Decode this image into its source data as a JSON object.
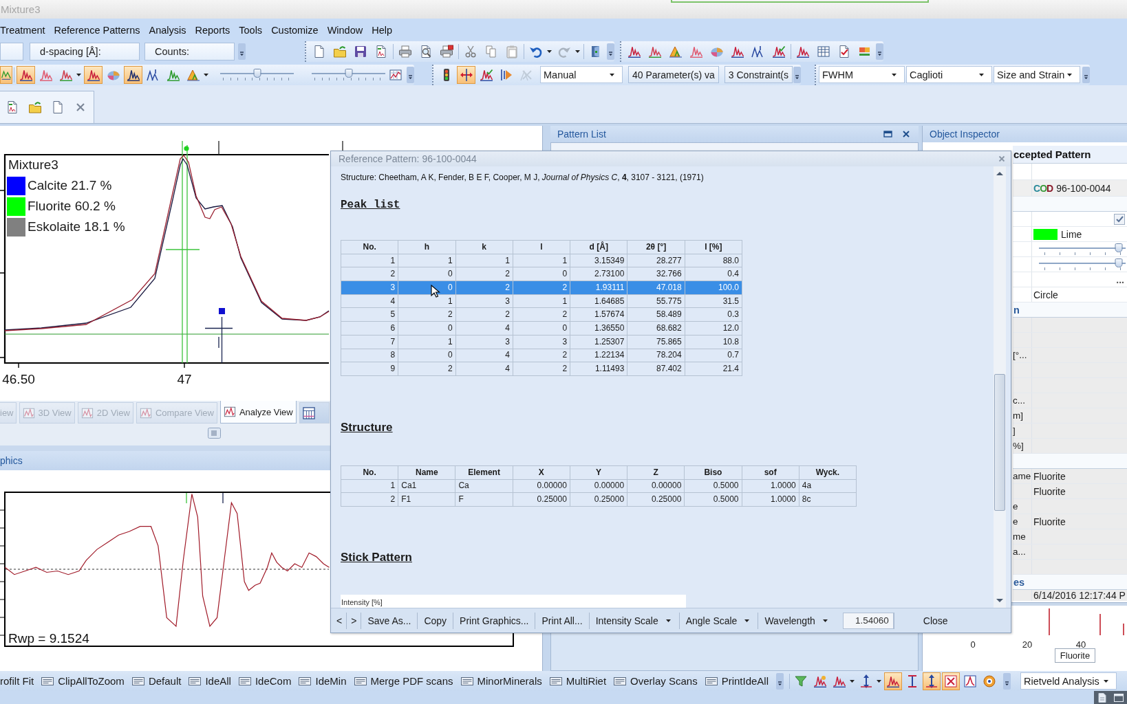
{
  "window": {
    "title": "Mixture3"
  },
  "menu": [
    "Treatment",
    "Reference Patterns",
    "Analysis",
    "Reports",
    "Tools",
    "Customize",
    "Window",
    "Help"
  ],
  "toolbar": {
    "readouts": [
      "d-spacing [Å]:",
      "Counts:"
    ],
    "view_toggles": [
      {
        "on": true
      },
      {
        "on": true
      },
      {
        "on": false
      },
      {
        "on": false
      },
      {
        "on": true
      },
      {
        "on": false
      },
      {
        "on": true
      },
      {
        "on": false
      },
      {
        "on": false
      },
      {
        "on": false
      }
    ],
    "sliders": [
      {
        "level": 0.5
      },
      {
        "level": 0.5
      }
    ],
    "refine_toggles": [
      {
        "on": false,
        "disabled": false
      },
      {
        "on": true,
        "disabled": false
      },
      {
        "on": false,
        "disabled": false
      },
      {
        "on": false,
        "disabled": false
      },
      {
        "on": false,
        "disabled": true
      }
    ],
    "refine_mode": "Manual",
    "counters": [
      "40 Parameter(s) va",
      "3 Constraint(s"
    ],
    "profile_settings": [
      "FWHM",
      "Caglioti",
      "Size and Strain"
    ]
  },
  "chart": {
    "legend_title": "Mixture3",
    "legend": [
      {
        "label": "Calcite 21.7 %",
        "color": "#0000ff"
      },
      {
        "label": "Fluorite 60.2 %",
        "color": "#00ff00"
      },
      {
        "label": "Eskolaite 18.1 %",
        "color": "#808080"
      }
    ],
    "x_labels": [
      "46.50",
      "47"
    ]
  },
  "view_tabs": [
    {
      "label": "iew",
      "kind": "text",
      "selected": false,
      "disabled": true
    },
    {
      "label": "3D View",
      "kind": "icon_text",
      "selected": false,
      "disabled": true
    },
    {
      "label": "2D View",
      "kind": "icon_text",
      "selected": false,
      "disabled": true
    },
    {
      "label": "Compare View",
      "kind": "icon_text",
      "selected": false,
      "disabled": true
    },
    {
      "label": "Analyze View",
      "kind": "icon_text",
      "selected": true,
      "disabled": false
    },
    {
      "kind": "icon",
      "selected": false,
      "disabled": false
    }
  ],
  "graphics_panel": {
    "title": "phics",
    "rwp": "Rwp = 9.1524"
  },
  "pattern_list": {
    "title": "Pattern List"
  },
  "object_inspector": {
    "title": "Object Inspector",
    "sections": [
      {
        "kind": "object",
        "title": "ccepted Pattern",
        "read_only": false,
        "rows": [
          {
            "kind": "blank"
          },
          {
            "kind": "source",
            "logo": "COD",
            "value": "96-100-0044"
          }
        ]
      },
      {
        "kind": "category",
        "read_only": false,
        "rows": [
          {
            "kind": "checkbox",
            "checked": true
          },
          {
            "kind": "color",
            "value": "Lime",
            "color": "#00ff00"
          },
          {
            "kind": "slider",
            "level": 0.92
          },
          {
            "kind": "slider",
            "level": 0.92
          },
          {
            "kind": "button",
            "value": "..."
          },
          {
            "kind": "text",
            "value": "Circle"
          }
        ]
      },
      {
        "kind": "category",
        "title": "n",
        "read_only": true,
        "rows": [
          {
            "kind": "blank"
          },
          {
            "kind": "blank"
          },
          {
            "kind": "text",
            "label": "[°..."
          },
          {
            "kind": "blank"
          },
          {
            "kind": "blank"
          },
          {
            "kind": "text",
            "label": "c..."
          },
          {
            "kind": "text",
            "label": "m]"
          },
          {
            "kind": "text",
            "label": "]"
          },
          {
            "kind": "text",
            "label": "%]"
          }
        ]
      },
      {
        "kind": "category",
        "read_only": true,
        "rows": [
          {
            "kind": "text",
            "label": "ame",
            "value": "Fluorite"
          },
          {
            "kind": "text",
            "value": "Fluorite"
          },
          {
            "kind": "text",
            "label": "e"
          },
          {
            "kind": "text",
            "label": "e",
            "value": "Fluorite"
          },
          {
            "kind": "text",
            "label": "me"
          },
          {
            "kind": "text",
            "label": "a..."
          },
          {
            "kind": "blank"
          }
        ]
      },
      {
        "kind": "category",
        "title": "es",
        "read_only": true,
        "rows": [
          {
            "kind": "text",
            "value": "6/14/2016 12:17:44 P"
          }
        ]
      }
    ],
    "preview": {
      "x_labels": [
        "0",
        "20",
        "40"
      ],
      "label": "Fluorite"
    }
  },
  "dialog": {
    "title": "Reference Pattern: 96-100-0044",
    "citation": "Structure: Cheetham, A K, Fender, B E F, Cooper, M J, *Journal of Physics C*, **4**, 3107 - 3121, (1971)",
    "peak_list": {
      "heading": "Peak list",
      "columns": [
        "No.",
        "h",
        "k",
        "l",
        "d [Å]",
        "2θ [°]",
        "I [%]"
      ],
      "rows": [
        {
          "cells": [
            "1",
            "1",
            "1",
            "1",
            "3.15349",
            "28.277",
            "88.0"
          ],
          "selected": false
        },
        {
          "cells": [
            "2",
            "0",
            "2",
            "0",
            "2.73100",
            "32.766",
            "0.4"
          ],
          "selected": false
        },
        {
          "cells": [
            "3",
            "0",
            "2",
            "2",
            "1.93111",
            "47.018",
            "100.0"
          ],
          "selected": true
        },
        {
          "cells": [
            "4",
            "1",
            "3",
            "1",
            "1.64685",
            "55.775",
            "31.5"
          ],
          "selected": false
        },
        {
          "cells": [
            "5",
            "2",
            "2",
            "2",
            "1.57674",
            "58.489",
            "0.3"
          ],
          "selected": false
        },
        {
          "cells": [
            "6",
            "0",
            "4",
            "0",
            "1.36550",
            "68.682",
            "12.0"
          ],
          "selected": false
        },
        {
          "cells": [
            "7",
            "1",
            "3",
            "3",
            "1.25307",
            "75.865",
            "10.8"
          ],
          "selected": false
        },
        {
          "cells": [
            "8",
            "0",
            "4",
            "2",
            "1.22134",
            "78.204",
            "0.7"
          ],
          "selected": false
        },
        {
          "cells": [
            "9",
            "2",
            "4",
            "2",
            "1.11493",
            "87.402",
            "21.4"
          ],
          "selected": false
        }
      ]
    },
    "structure": {
      "heading": "Structure",
      "columns": [
        "No.",
        "Name",
        "Element",
        "X",
        "Y",
        "Z",
        "Biso",
        "sof",
        "Wyck."
      ],
      "rows": [
        [
          "1",
          "Ca1",
          "Ca",
          "0.00000",
          "0.00000",
          "0.00000",
          "0.5000",
          "1.0000",
          "4a"
        ],
        [
          "2",
          "F1",
          "F",
          "0.25000",
          "0.25000",
          "0.25000",
          "0.5000",
          "1.0000",
          "8c"
        ]
      ]
    },
    "stick_pattern": {
      "heading": "Stick Pattern",
      "axis_title": "Intensity [%]"
    },
    "buttons": [
      {
        "kind": "button",
        "label": "<"
      },
      {
        "kind": "button",
        "label": ">"
      },
      {
        "kind": "button",
        "label": "Save As..."
      },
      {
        "kind": "button",
        "label": "Copy"
      },
      {
        "kind": "button",
        "label": "Print Graphics..."
      },
      {
        "kind": "button",
        "label": "Print All..."
      },
      {
        "kind": "dropdown",
        "label": "Intensity Scale"
      },
      {
        "kind": "dropdown",
        "label": "Angle Scale"
      },
      {
        "kind": "dropdown",
        "label": "Wavelength"
      },
      {
        "kind": "field",
        "value": "1.54060"
      },
      {
        "kind": "button",
        "label": "Close"
      }
    ]
  },
  "macro_bar": {
    "items": [
      {
        "kind": "text",
        "label": "rofilt Fit"
      },
      {
        "kind": "macro",
        "label": "ClipAllToZoom"
      },
      {
        "kind": "macro",
        "label": "Default"
      },
      {
        "kind": "macro",
        "label": "IdeAll"
      },
      {
        "kind": "macro",
        "label": "IdeCom"
      },
      {
        "kind": "macro",
        "label": "IdeMin"
      },
      {
        "kind": "macro",
        "label": "Merge PDF scans"
      },
      {
        "kind": "macro",
        "label": "MinorMinerals"
      },
      {
        "kind": "macro",
        "label": "MultiRiet"
      },
      {
        "kind": "macro",
        "label": "Overlay Scans"
      },
      {
        "kind": "macro",
        "label": "PrintIdeAll"
      }
    ],
    "toggles": [
      {
        "on": false
      },
      {
        "on": false
      },
      {
        "on": false
      },
      {
        "on": false
      },
      {
        "on": true
      },
      {
        "on": false
      },
      {
        "on": true
      },
      {
        "on": true
      },
      {
        "on": false
      },
      {
        "on": false
      }
    ],
    "mode": "Rietveld Analysis"
  }
}
